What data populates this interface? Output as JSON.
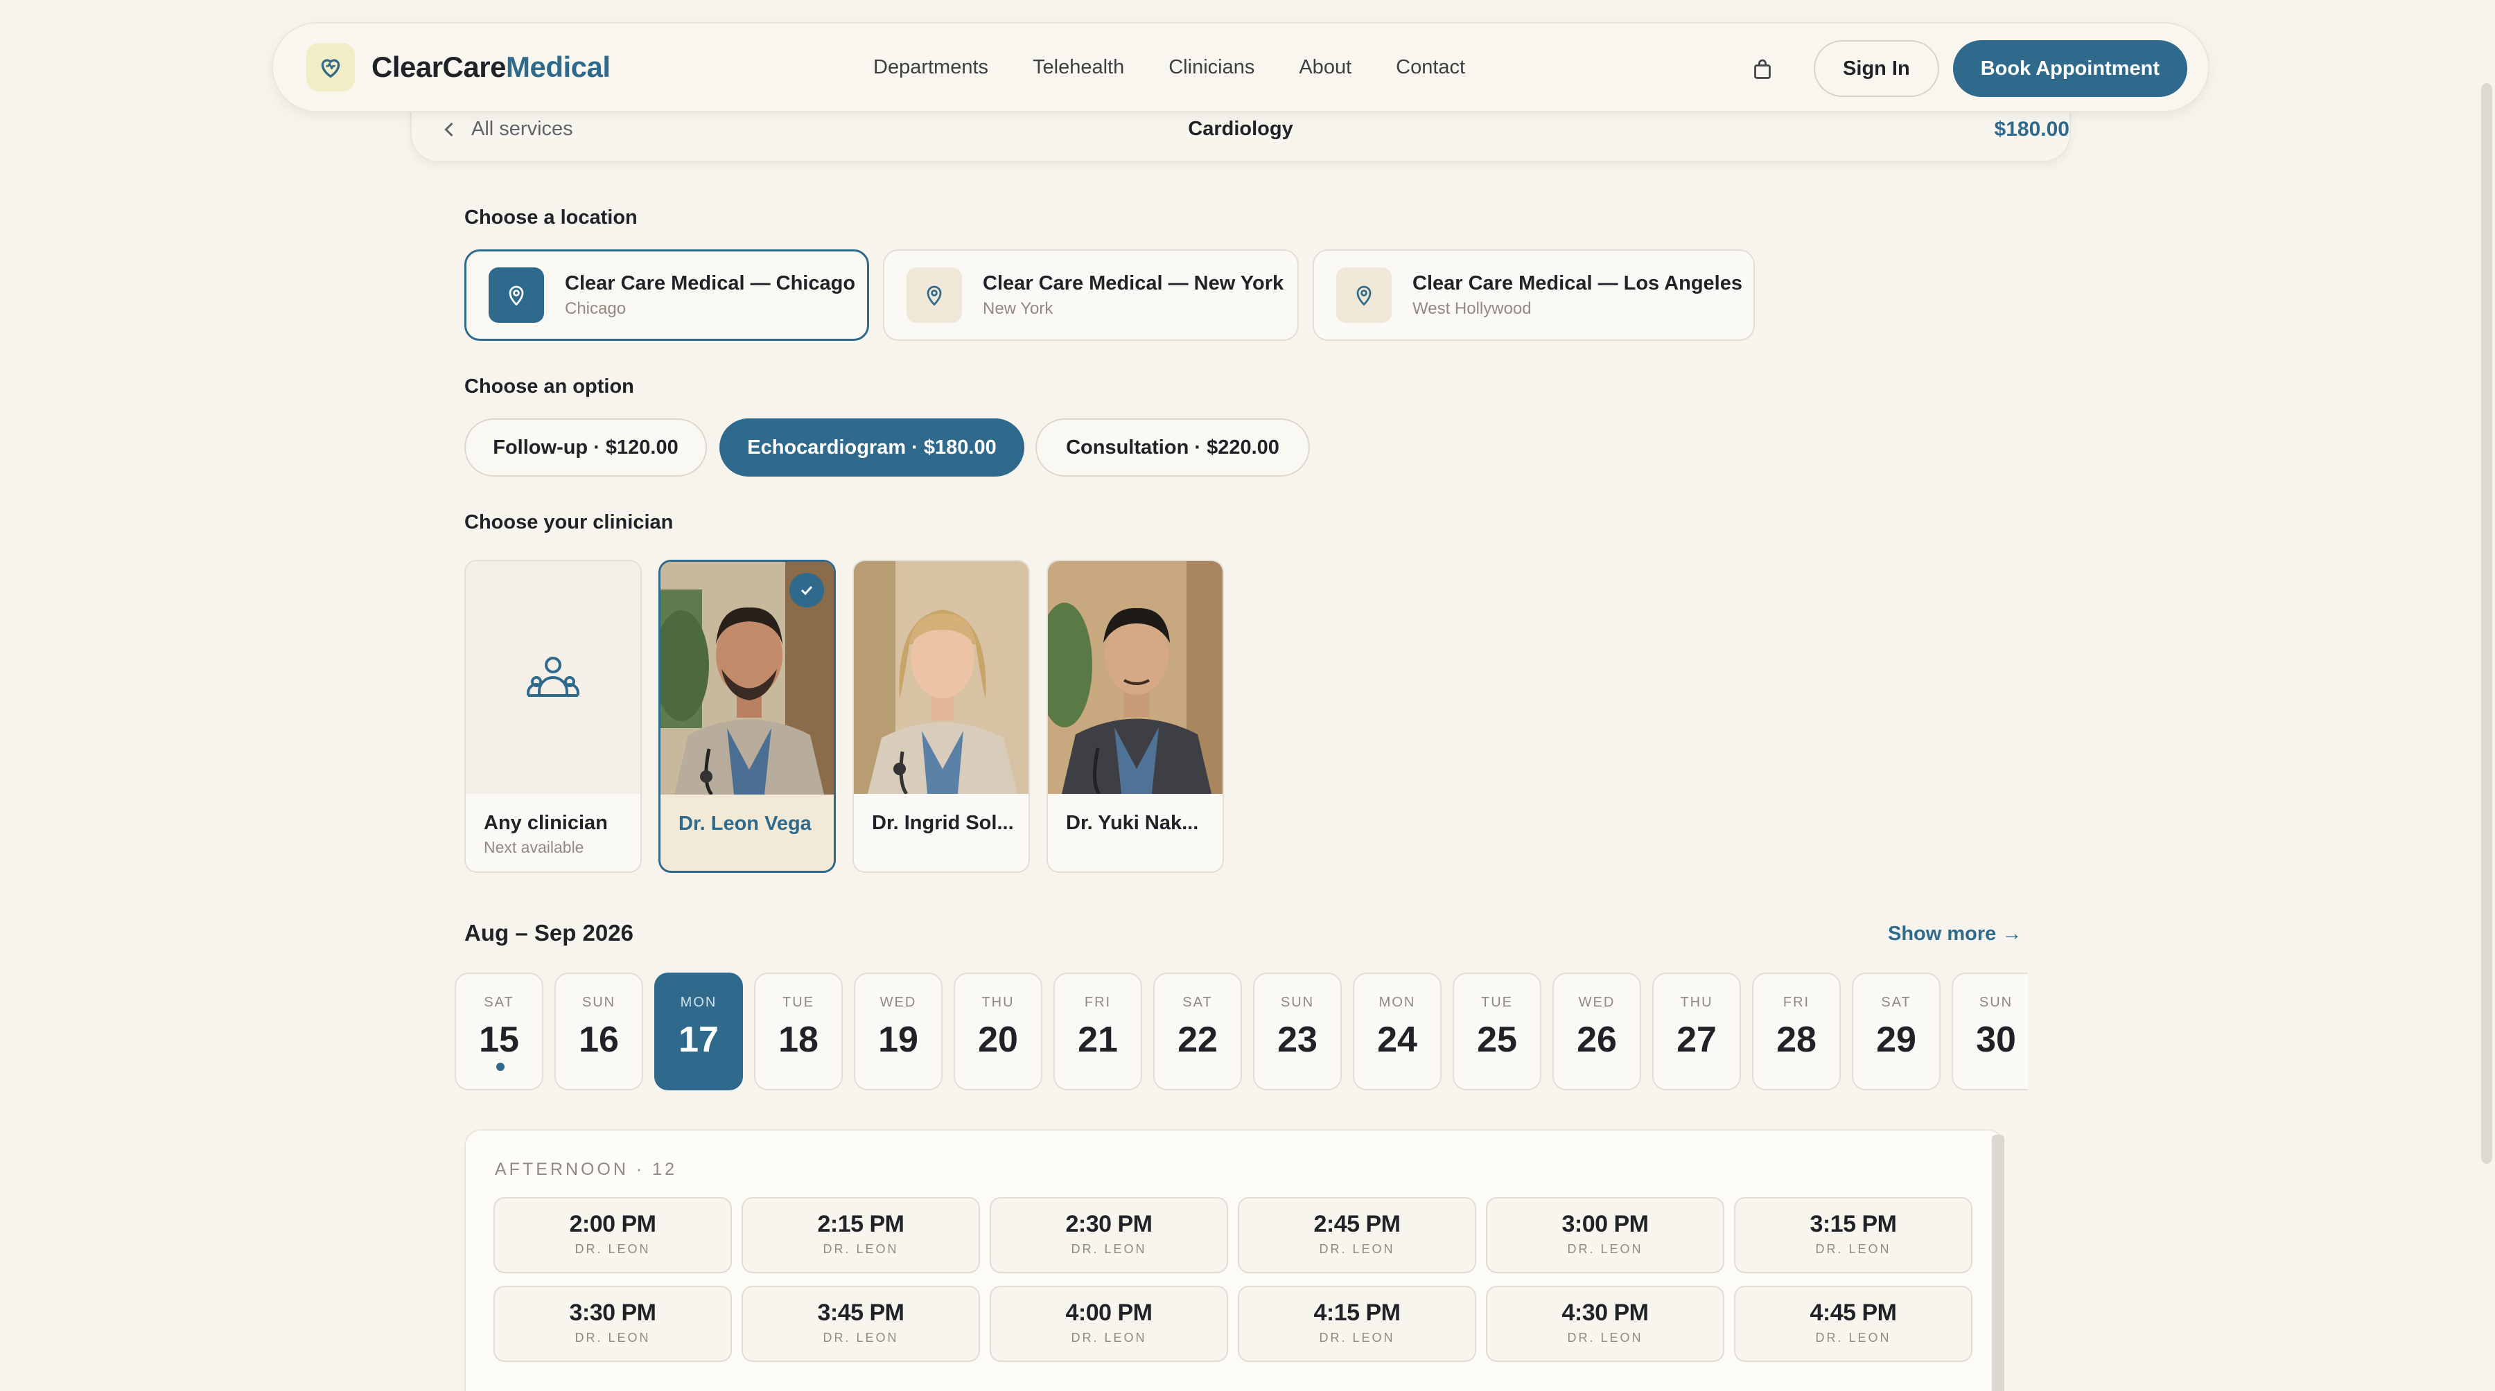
{
  "header": {
    "brand_primary": "ClearCare",
    "brand_accent": "Medical",
    "nav": [
      "Departments",
      "Telehealth",
      "Clinicians",
      "About",
      "Contact"
    ],
    "signin_label": "Sign In",
    "book_label": "Book Appointment"
  },
  "subbar": {
    "back_label": "All services",
    "title": "Cardiology",
    "price": "$180.00"
  },
  "location_section": {
    "label": "Choose a location",
    "items": [
      {
        "name": "Clear Care Medical — Chicago",
        "city": "Chicago",
        "selected": true
      },
      {
        "name": "Clear Care Medical — New York",
        "city": "New York",
        "selected": false
      },
      {
        "name": "Clear Care Medical — Los Angeles",
        "city": "West Hollywood",
        "selected": false
      }
    ]
  },
  "option_section": {
    "label": "Choose an option",
    "items": [
      {
        "label": "Follow-up · $120.00",
        "selected": false
      },
      {
        "label": "Echocardiogram · $180.00",
        "selected": true
      },
      {
        "label": "Consultation · $220.00",
        "selected": false
      }
    ]
  },
  "clinician_section": {
    "label": "Choose your clinician",
    "items": [
      {
        "name": "Any clinician",
        "sub": "Next available",
        "selected": false
      },
      {
        "name": "Dr. Leon Vega",
        "selected": true
      },
      {
        "name": "Dr. Ingrid Sol...",
        "selected": false
      },
      {
        "name": "Dr. Yuki Nak...",
        "selected": false
      }
    ]
  },
  "date_section": {
    "range": "Aug – Sep 2026",
    "show_more": "Show more →",
    "days": [
      {
        "dow": "SAT",
        "num": "15",
        "today": true
      },
      {
        "dow": "SUN",
        "num": "16"
      },
      {
        "dow": "MON",
        "num": "17",
        "selected": true
      },
      {
        "dow": "TUE",
        "num": "18"
      },
      {
        "dow": "WED",
        "num": "19"
      },
      {
        "dow": "THU",
        "num": "20"
      },
      {
        "dow": "FRI",
        "num": "21"
      },
      {
        "dow": "SAT",
        "num": "22"
      },
      {
        "dow": "SUN",
        "num": "23"
      },
      {
        "dow": "MON",
        "num": "24"
      },
      {
        "dow": "TUE",
        "num": "25"
      },
      {
        "dow": "WED",
        "num": "26"
      },
      {
        "dow": "THU",
        "num": "27"
      },
      {
        "dow": "FRI",
        "num": "28"
      },
      {
        "dow": "SAT",
        "num": "29"
      },
      {
        "dow": "SUN",
        "num": "30"
      }
    ]
  },
  "slots_section": {
    "period_label": "AFTERNOON · 12",
    "slots": [
      {
        "time": "2:00 PM",
        "doc": "DR. LEON"
      },
      {
        "time": "2:15 PM",
        "doc": "DR. LEON"
      },
      {
        "time": "2:30 PM",
        "doc": "DR. LEON"
      },
      {
        "time": "2:45 PM",
        "doc": "DR. LEON"
      },
      {
        "time": "3:00 PM",
        "doc": "DR. LEON"
      },
      {
        "time": "3:15 PM",
        "doc": "DR. LEON"
      },
      {
        "time": "3:30 PM",
        "doc": "DR. LEON"
      },
      {
        "time": "3:45 PM",
        "doc": "DR. LEON"
      },
      {
        "time": "4:00 PM",
        "doc": "DR. LEON"
      },
      {
        "time": "4:15 PM",
        "doc": "DR. LEON"
      },
      {
        "time": "4:30 PM",
        "doc": "DR. LEON"
      },
      {
        "time": "4:45 PM",
        "doc": "DR. LEON"
      }
    ]
  },
  "colors": {
    "accent": "#2f6a8c",
    "background": "#f7f4ee",
    "selected_card": "#f2ead7"
  }
}
